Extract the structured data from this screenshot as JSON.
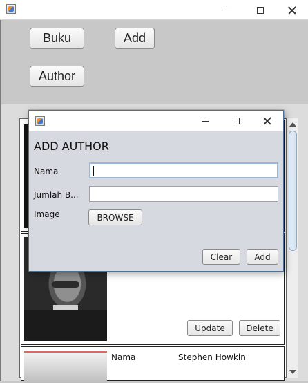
{
  "main_window": {
    "buttons": {
      "buku": "Buku",
      "add": "Add",
      "author": "Author"
    }
  },
  "author_cards": [
    {
      "buttons": {
        "update": "Update",
        "delete": "Delete"
      }
    },
    {
      "fields": {
        "nama_label": "Nama",
        "nama_value": "Stephen Howkin"
      }
    }
  ],
  "dialog": {
    "heading": "ADD AUTHOR",
    "labels": {
      "nama": "Nama",
      "jumlah_buku": "Jumlah B...",
      "image": "Image"
    },
    "inputs": {
      "nama_value": "",
      "jumlah_buku_value": ""
    },
    "buttons": {
      "browse": "BROWSE",
      "clear": "Clear",
      "add": "Add"
    }
  },
  "icons": {
    "app": "java-cup-icon",
    "minimize": "minimize-icon",
    "maximize": "maximize-icon",
    "close": "close-icon"
  },
  "colors": {
    "dialog_background": "#d6d9df",
    "main_background": "#c8c8c8",
    "input_focus_border": "#9bb6d4"
  }
}
